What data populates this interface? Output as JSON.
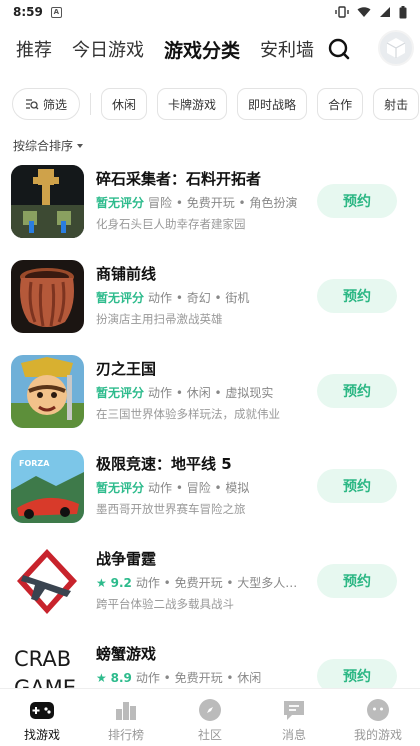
{
  "status_bar": {
    "time": "8:59",
    "notification": "A"
  },
  "top_tabs": [
    {
      "label": "推荐",
      "active": false
    },
    {
      "label": "今日游戏",
      "active": false
    },
    {
      "label": "游戏分类",
      "active": true
    },
    {
      "label": "安利墙",
      "active": false
    }
  ],
  "filters": {
    "filter_label": "筛选",
    "categories": [
      "休闲",
      "卡牌游戏",
      "即时战略",
      "合作",
      "射击"
    ]
  },
  "sort": {
    "label": "按综合排序"
  },
  "games": [
    {
      "title": "碎石采集者：石料开拓者",
      "rating": "暂无评分",
      "has_star": false,
      "tags": "冒险 • 免费开玩 • 角色扮演",
      "desc": "化身石头巨人助幸存者建家园",
      "button": "预约"
    },
    {
      "title": "商铺前线",
      "rating": "暂无评分",
      "has_star": false,
      "tags": "动作 • 奇幻 • 街机",
      "desc": "扮演店主用扫帚激战英雄",
      "button": "预约"
    },
    {
      "title": "刃之王国",
      "rating": "暂无评分",
      "has_star": false,
      "tags": "动作 • 休闲 • 虚拟现实",
      "desc": "在三国世界体验多样玩法，成就伟业",
      "button": "预约"
    },
    {
      "title": "极限竞速：地平线 5",
      "rating": "暂无评分",
      "has_star": false,
      "tags": "动作 • 冒险 • 模拟",
      "desc": "墨西哥开放世界赛车冒险之旅",
      "button": "预约",
      "icon_text": "FORZA"
    },
    {
      "title": "战争雷霆",
      "rating": "9.2",
      "has_star": true,
      "tags": "动作 • 免费开玩 • 大型多人…",
      "desc": "跨平台体验二战多载具战斗",
      "button": "预约"
    },
    {
      "title": "螃蟹游戏",
      "rating": "8.9",
      "has_star": true,
      "tags": "动作 • 免费开玩 • 休闲",
      "desc": "",
      "button": "预约",
      "icon_text_1": "CRAB",
      "icon_text_2": "GAME"
    }
  ],
  "bottom_nav": [
    {
      "label": "找游戏",
      "icon": "gamepad-icon",
      "active": true
    },
    {
      "label": "排行榜",
      "icon": "ranking-icon",
      "active": false
    },
    {
      "label": "社区",
      "icon": "compass-icon",
      "active": false
    },
    {
      "label": "消息",
      "icon": "message-icon",
      "active": false
    },
    {
      "label": "我的游戏",
      "icon": "my-games-icon",
      "active": false
    }
  ],
  "colors": {
    "accent": "#2dbb8c",
    "button_bg": "#e7f8f0",
    "underline": "#3dc79a"
  }
}
